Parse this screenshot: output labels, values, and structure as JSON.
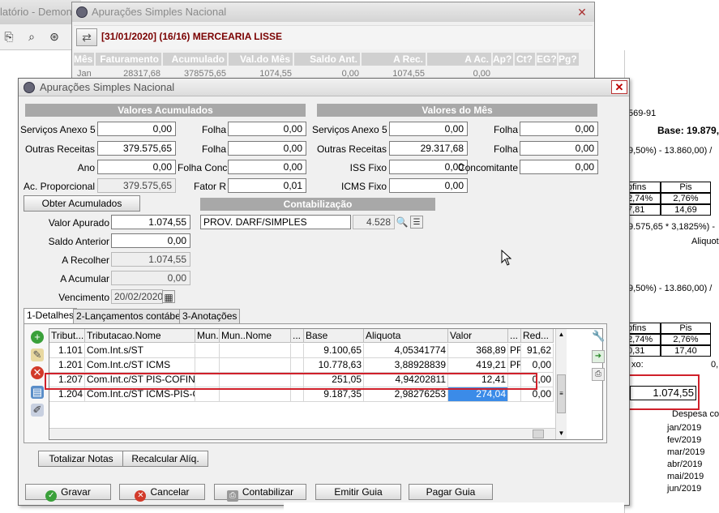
{
  "background": {
    "title_fragment": "latório - Demon",
    "report": {
      "code": "569-91",
      "base_label": "Base: 19.879,",
      "formula1": "9,50%) - 13.860,00) /",
      "table1": {
        "h1": "ofins",
        "h2": "Pis",
        "r1c1": "2,74%",
        "r1c2": "2,76%",
        "r2c1": "7,81",
        "r2c2": "14,69"
      },
      "formula2": "9.575,65 * 3,1825%) -",
      "aliquot_frag": "Aliquot",
      "formula3": "9,50%) - 13.860,00) /",
      "table2": {
        "h1": "ofins",
        "h2": "Pis",
        "r1c1": "2,74%",
        "r1c2": "2,76%",
        "r2c1": "0,31",
        "r2c2": "17,40"
      },
      "xo": "xo:",
      "xo_val": "0,",
      "highlight_value": "1.074,55",
      "despesa": "Despesa co",
      "months": [
        "jan/2019",
        "fev/2019",
        "mar/2019",
        "abr/2019",
        "mai/2019",
        "jun/2019"
      ]
    },
    "window": {
      "title": "Apurações Simples Nacional",
      "header": "[31/01/2020] (16/16) MERCEARIA LISSE",
      "columns": [
        "Mês",
        "Faturamento",
        "Acumulado",
        "Val.do Mês",
        "Saldo Ant.",
        "A Rec.",
        "A Ac.",
        "Ap?",
        "Ct?",
        "EG?",
        "Pg?"
      ],
      "row": [
        "Jan",
        "28317,68",
        "378575,65",
        "1074,55",
        "0,00",
        "1074,55",
        "0,00"
      ]
    }
  },
  "dialog": {
    "title": "Apurações Simples Nacional",
    "close": "✕",
    "acumulados": {
      "heading": "Valores Acumulados",
      "servicos_label": "Serviços Anexo 5",
      "servicos": "0,00",
      "outras_label": "Outras Receitas",
      "outras": "379.575,65",
      "ano_label": "Ano",
      "ano": "0,00",
      "acprop_label": "Ac. Proporcional",
      "acprop": "379.575,65",
      "folha1_label": "Folha",
      "folha1": "0,00",
      "folha2_label": "Folha",
      "folha2": "0,00",
      "folhaconc_label": "Folha Conc.",
      "folhaconc": "0,00",
      "fatorr_label": "Fator R",
      "fatorr": "0,01"
    },
    "mes": {
      "heading": "Valores do Mês",
      "servicos_label": "Serviços Anexo 5",
      "servicos": "0,00",
      "outras_label": "Outras Receitas",
      "outras": "29.317,68",
      "iss_label": "ISS Fixo",
      "iss": "0,00",
      "icms_label": "ICMS Fixo",
      "icms": "0,00",
      "folha1_label": "Folha",
      "folha1": "0,00",
      "folha2_label": "Folha",
      "folha2": "0,00",
      "concomitante_label": "Concomitante",
      "concomitante": "0,00"
    },
    "obter_button": "Obter Acumulados",
    "valor_apurado_label": "Valor Apurado",
    "valor_apurado": "1.074,55",
    "saldo_anterior_label": "Saldo Anterior",
    "saldo_anterior": "0,00",
    "a_recolher_label": "A Recolher",
    "a_recolher": "1.074,55",
    "a_acumular_label": "A Acumular",
    "a_acumular": "0,00",
    "vencimento_label": "Vencimento",
    "vencimento": "20/02/2020",
    "contab": {
      "heading": "Contabilização",
      "conta": "PROV. DARF/SIMPLES",
      "codigo": "4.528"
    },
    "tabs": [
      "1-Detalhes",
      "2-Lançamentos contábeis",
      "3-Anotações"
    ],
    "grid": {
      "headers": [
        "Tribut...",
        "Tributacao.Nome",
        "Mun.",
        "Mun..Nome",
        "...",
        "Base",
        "Aliquota",
        "Valor",
        "...",
        "Red..."
      ],
      "rows": [
        [
          "1.101",
          "Com.Int.s/ST",
          "",
          "",
          "",
          "9.100,65",
          "4,05341774",
          "368,89",
          "PR",
          "91,62"
        ],
        [
          "1.201",
          "Com.Int.c/ST ICMS",
          "",
          "",
          "",
          "10.778,63",
          "3,88928839",
          "419,21",
          "PR",
          "0,00"
        ],
        [
          "1.207",
          "Com.Int.c/ST PIS-COFINS",
          "",
          "",
          "",
          "251,05",
          "4,94202811",
          "12,41",
          "",
          "0,00"
        ],
        [
          "1.204",
          "Com.Int.c/ST ICMS-PIS-COFINS",
          "",
          "",
          "",
          "9.187,35",
          "2,98276253",
          "274,04",
          "",
          "0,00"
        ]
      ]
    },
    "totalizar_button": "Totalizar Notas",
    "recalcular_button": "Recalcular Alíq.",
    "footer": {
      "gravar": "Gravar",
      "cancelar": "Cancelar",
      "contabilizar": "Contabilizar",
      "emitir": "Emitir Guia",
      "pagar": "Pagar Guia"
    },
    "colors": {
      "highlight": "#d0202a",
      "section": "#a8a8a8",
      "selected": "#3b8be8"
    }
  }
}
